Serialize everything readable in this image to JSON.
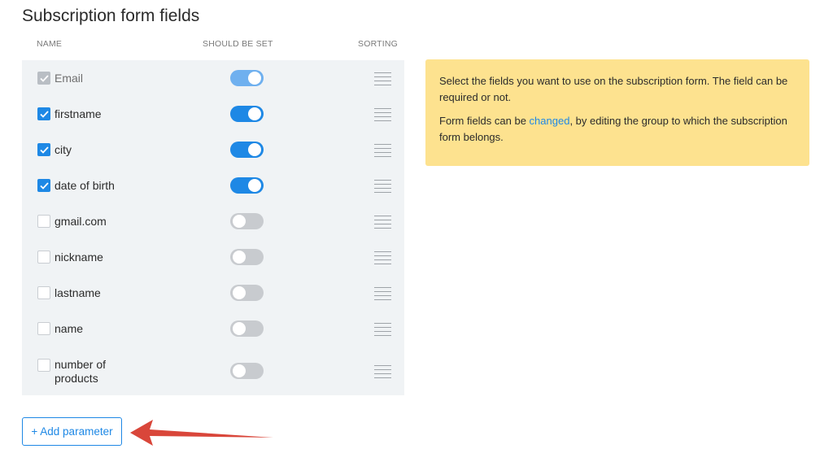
{
  "section": {
    "title": "Subscription form fields"
  },
  "columns": {
    "name": "NAME",
    "should_be_set": "SHOULD BE SET",
    "sorting": "SORTING"
  },
  "fields": [
    {
      "label": "Email",
      "checked": true,
      "required": true,
      "disabled": true
    },
    {
      "label": "firstname",
      "checked": true,
      "required": true,
      "disabled": false
    },
    {
      "label": "city",
      "checked": true,
      "required": true,
      "disabled": false
    },
    {
      "label": "date of birth",
      "checked": true,
      "required": true,
      "disabled": false
    },
    {
      "label": "gmail.com",
      "checked": false,
      "required": false,
      "disabled": false
    },
    {
      "label": "nickname",
      "checked": false,
      "required": false,
      "disabled": false
    },
    {
      "label": "lastname",
      "checked": false,
      "required": false,
      "disabled": false
    },
    {
      "label": "name",
      "checked": false,
      "required": false,
      "disabled": false
    },
    {
      "label_line1": "number of",
      "label_line2": "products",
      "checked": false,
      "required": false,
      "disabled": false
    }
  ],
  "info": {
    "text1": "Select the fields you want to use on the subscription form. The field can be required or not.",
    "text2_before": "Form fields can be ",
    "text2_link": "changed",
    "text2_after": ", by editing the group to which the subscription form belongs."
  },
  "add_button": {
    "label": "+ Add parameter"
  },
  "colors": {
    "accent": "#1e88e5",
    "info_bg": "#fde28f",
    "table_bg": "#f0f3f5",
    "arrow": "#d9463a"
  },
  "icons": {
    "check": "check-icon",
    "drag": "drag-handle-icon",
    "arrow": "arrow-left-icon"
  }
}
